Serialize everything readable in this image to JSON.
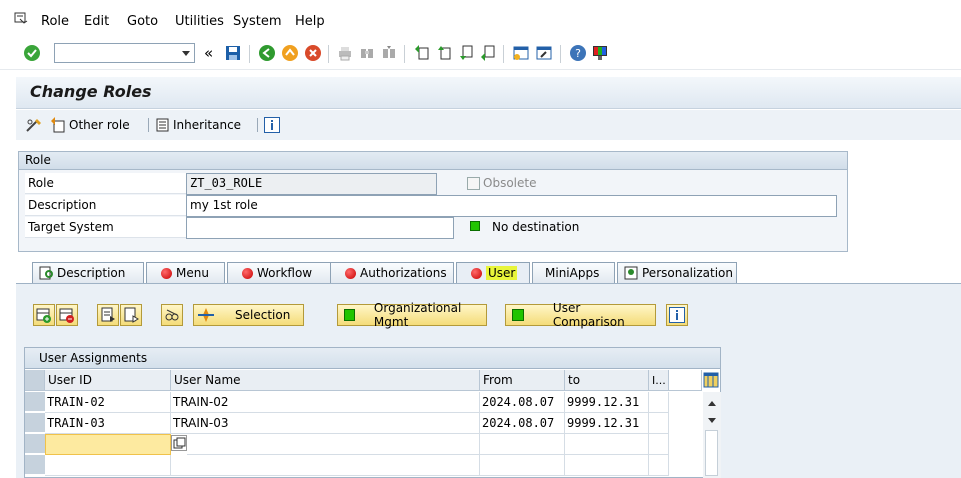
{
  "menu": {
    "items": [
      "Role",
      "Edit",
      "Goto",
      "Utilities",
      "System",
      "Help"
    ]
  },
  "toolbar": {
    "command_field_value": "",
    "double_chevron": "«"
  },
  "page": {
    "title": "Change Roles"
  },
  "app_toolbar": {
    "other_role_label": "Other role",
    "inheritance_label": "Inheritance"
  },
  "role_group": {
    "header": "Role",
    "role_label": "Role",
    "role_value": "ZT_03_ROLE",
    "obsolete_label": "Obsolete",
    "description_label": "Description",
    "description_value": "my 1st role",
    "target_system_label": "Target System",
    "target_system_value": "",
    "no_destination_label": "No destination"
  },
  "tabs": [
    {
      "label": "Description",
      "status": "icon"
    },
    {
      "label": "Menu",
      "status": "red"
    },
    {
      "label": "Workflow",
      "status": "red"
    },
    {
      "label": "Authorizations",
      "status": "red"
    },
    {
      "label": "User",
      "status": "red",
      "active": true
    },
    {
      "label": "MiniApps",
      "status": "none"
    },
    {
      "label": "Personalization",
      "status": "icon"
    }
  ],
  "user_tab": {
    "selection_button": "Selection",
    "org_mgmt_button": "Organizational Mgmt",
    "user_comparison_button": "User Comparison"
  },
  "assignments": {
    "title": "User Assignments",
    "columns": [
      "User ID",
      "User Name",
      "From",
      "to",
      "I..."
    ],
    "rows": [
      {
        "user_id": "TRAIN-02",
        "user_name": "TRAIN-02",
        "from": "2024.08.07",
        "to": "9999.12.31"
      },
      {
        "user_id": "TRAIN-03",
        "user_name": "TRAIN-03",
        "from": "2024.08.07",
        "to": "9999.12.31"
      }
    ]
  },
  "colors": {
    "accent_green": "#21c400",
    "status_red": "#c80000",
    "button_yellow": "#f4dc79",
    "highlight": "#e8f53a"
  }
}
